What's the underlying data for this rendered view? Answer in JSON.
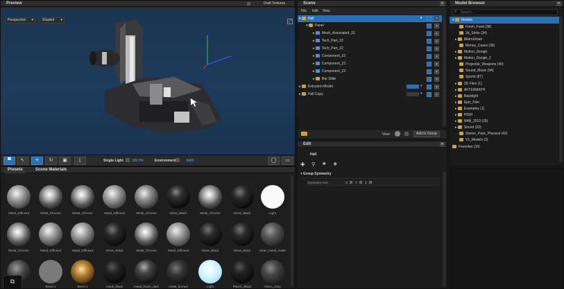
{
  "preview": {
    "title": "Preview",
    "draft_textures": "Draft Textures",
    "camera_dropdown": "Perspective",
    "mode_dropdown": "Shaded",
    "lighting_label": "Single Light",
    "zoom_value": "100.0%",
    "environment_label": "Environment",
    "environment_value": "ibl03"
  },
  "materials": {
    "tabs": [
      "Presets",
      "Scene Materials"
    ],
    "row1": [
      "Metal_Diffused",
      "Metal_Chrome",
      "Metal_Chrome",
      "Metal_Diffused",
      "Metal_Chrome",
      "Gloss_Black",
      "Metal_Chrome",
      "Gloss_Black",
      "Light"
    ],
    "row2": [
      "Metal_Chrome",
      "Metal_Diffused",
      "Metal_Diffused",
      "Gloss_Black",
      "Metal_Chrome",
      "Metal_Diffused",
      "Gloss_Black",
      "Gloss_Black",
      "clean_metal_matte"
    ],
    "row3": [
      "",
      "Bevel 1",
      "Bevel 1",
      "metal_black",
      "metal_brush_dark",
      "metal_burned",
      "Light",
      "Plastic_Black",
      "Gloss_Grey"
    ]
  },
  "scene": {
    "title": "Scene",
    "menu": [
      "File",
      "Edit",
      "View"
    ],
    "rows": [
      {
        "label": "Hall",
        "icon": "folder",
        "depth": 0,
        "selected": true
      },
      {
        "label": "Panel",
        "icon": "folder",
        "depth": 1,
        "selected": false
      },
      {
        "label": "Mesh_Associated_22",
        "icon": "cube",
        "depth": 2,
        "selected": false
      },
      {
        "label": "Tech_Part_22",
        "icon": "cube",
        "depth": 2,
        "selected": false
      },
      {
        "label": "Tech_Part_22",
        "icon": "cube",
        "depth": 2,
        "selected": false
      },
      {
        "label": "Component_22",
        "icon": "cube",
        "depth": 2,
        "selected": false
      },
      {
        "label": "Component_22",
        "icon": "cube",
        "depth": 2,
        "selected": false
      },
      {
        "label": "Component_22",
        "icon": "cube",
        "depth": 2,
        "selected": false
      },
      {
        "label": "Bar Slide",
        "icon": "folder",
        "depth": 2,
        "selected": false
      },
      {
        "label": "Extrusion Model",
        "icon": "folder",
        "depth": 0,
        "selected": false
      },
      {
        "label": "Hall Copy",
        "icon": "folder",
        "depth": 0,
        "selected": false
      }
    ],
    "view_label": "View",
    "add_to_group": "Add to Group"
  },
  "edit": {
    "title": "Edit",
    "object_name": "Hall",
    "section": "Group Symmetry",
    "symmetry_label": "Symmetry Axis",
    "axes": [
      "X",
      "Y",
      "Z"
    ]
  },
  "model_browser": {
    "title": "Model Browser",
    "search_placeholder": "Search...",
    "items": [
      {
        "label": "Models",
        "depth": 0,
        "selected": true
      },
      {
        "label": "Fresh_Food (38)",
        "depth": 1
      },
      {
        "label": "3d_Sinks (34)",
        "depth": 1
      },
      {
        "label": "MetroUrban",
        "depth": 1
      },
      {
        "label": "Money_Cases (38)",
        "depth": 1
      },
      {
        "label": "Motion_Design",
        "depth": 1
      },
      {
        "label": "Motion_Design_2",
        "depth": 1
      },
      {
        "label": "Projectile_Weapons (40)",
        "depth": 1
      },
      {
        "label": "Sound_Music (94)",
        "depth": 1
      },
      {
        "label": "Sports (87)",
        "depth": 1
      },
      {
        "label": "3D Files (1)",
        "depth": 1
      },
      {
        "label": "AFTERMATH",
        "depth": 1
      },
      {
        "label": "Backlight",
        "depth": 1
      },
      {
        "label": "Epic_Film",
        "depth": 1
      },
      {
        "label": "Examples (1)",
        "depth": 1
      },
      {
        "label": "HDRI",
        "depth": 1
      },
      {
        "label": "NAB_2013 (26)",
        "depth": 1
      },
      {
        "label": "Secret (22)",
        "depth": 1
      },
      {
        "label": "Starter_Pack_Physical (42)",
        "depth": 1
      },
      {
        "label": "V1_Models (3)",
        "depth": 1
      },
      {
        "label": "Favorites (10)",
        "depth": 0
      }
    ]
  }
}
